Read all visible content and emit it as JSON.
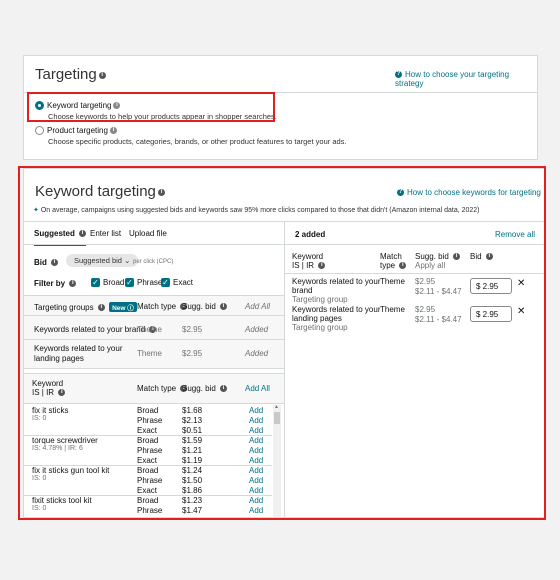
{
  "targeting": {
    "title": "Targeting",
    "help_link": "How to choose your targeting strategy",
    "options": [
      {
        "label": "Keyword targeting",
        "desc": "Choose keywords to help your products appear in shopper searches.",
        "selected": true
      },
      {
        "label": "Product targeting",
        "desc": "Choose specific products, categories, brands, or other product features to target your ads.",
        "selected": false
      }
    ]
  },
  "keyword": {
    "title": "Keyword targeting",
    "help_link": "How to choose keywords for targeting",
    "note": "On average, campaigns using suggested bids and keywords saw 95% more clicks compared to those that didn't (Amazon internal data, 2022)",
    "tabs": [
      "Suggested",
      "Enter list",
      "Upload file"
    ],
    "bid_label": "Bid",
    "bid_select": "Suggested bid",
    "per_click": "per click (CPC)",
    "filter_label": "Filter by",
    "filters": [
      "Broad",
      "Phrase",
      "Exact"
    ],
    "groups_header": {
      "col1": "Targeting groups",
      "new": "New",
      "col2": "Match type",
      "col3": "Sugg. bid",
      "col4": "Add All"
    },
    "groups": [
      {
        "name": "Keywords related to your brand",
        "type": "Theme",
        "bid": "$2.95",
        "status": "Added"
      },
      {
        "name": "Keywords related to your landing pages",
        "type": "Theme",
        "bid": "$2.95",
        "status": "Added"
      }
    ],
    "kw_header": {
      "col1": "Keyword",
      "col1b": "IS | IR",
      "col2": "Match type",
      "col3": "Sugg. bid",
      "col4": "Add All"
    },
    "keywords": [
      {
        "name": "fix it sticks",
        "metric": "IS: 0",
        "rows": [
          [
            "Broad",
            "$1.68"
          ],
          [
            "Phrase",
            "$2.13"
          ],
          [
            "Exact",
            "$0.51"
          ]
        ]
      },
      {
        "name": "torque screwdriver",
        "metric": "IS: 4.78% | IR: 6",
        "rows": [
          [
            "Broad",
            "$1.59"
          ],
          [
            "Phrase",
            "$1.21"
          ],
          [
            "Exact",
            "$1.19"
          ]
        ]
      },
      {
        "name": "fix it sticks gun tool kit",
        "metric": "IS: 0",
        "rows": [
          [
            "Broad",
            "$1.24"
          ],
          [
            "Phrase",
            "$1.50"
          ],
          [
            "Exact",
            "$1.86"
          ]
        ]
      },
      {
        "name": "fixit sticks tool kit",
        "metric": "IS: 0",
        "rows": [
          [
            "Broad",
            "$1.23"
          ],
          [
            "Phrase",
            "$1.47"
          ]
        ]
      }
    ],
    "add_label": "Add",
    "added": {
      "count_label": "2 added",
      "remove_all": "Remove all",
      "header": {
        "col1": "Keyword",
        "col1b": "IS | IR",
        "col2": "Match",
        "col2b": "type",
        "col3": "Sugg. bid",
        "col3b": "Apply all",
        "col4": "Bid"
      },
      "rows": [
        {
          "l1": "Keywords related to your",
          "l2": "brand",
          "group": "Targeting group",
          "type": "Theme",
          "bid": "$2.95",
          "range": "$2.11 - $4.47",
          "value": "2.95"
        },
        {
          "l1": "Keywords related to your",
          "l2": "landing pages",
          "group": "Targeting group",
          "type": "Theme",
          "bid": "$2.95",
          "range": "$2.11 - $4.47",
          "value": "2.95"
        }
      ]
    }
  }
}
